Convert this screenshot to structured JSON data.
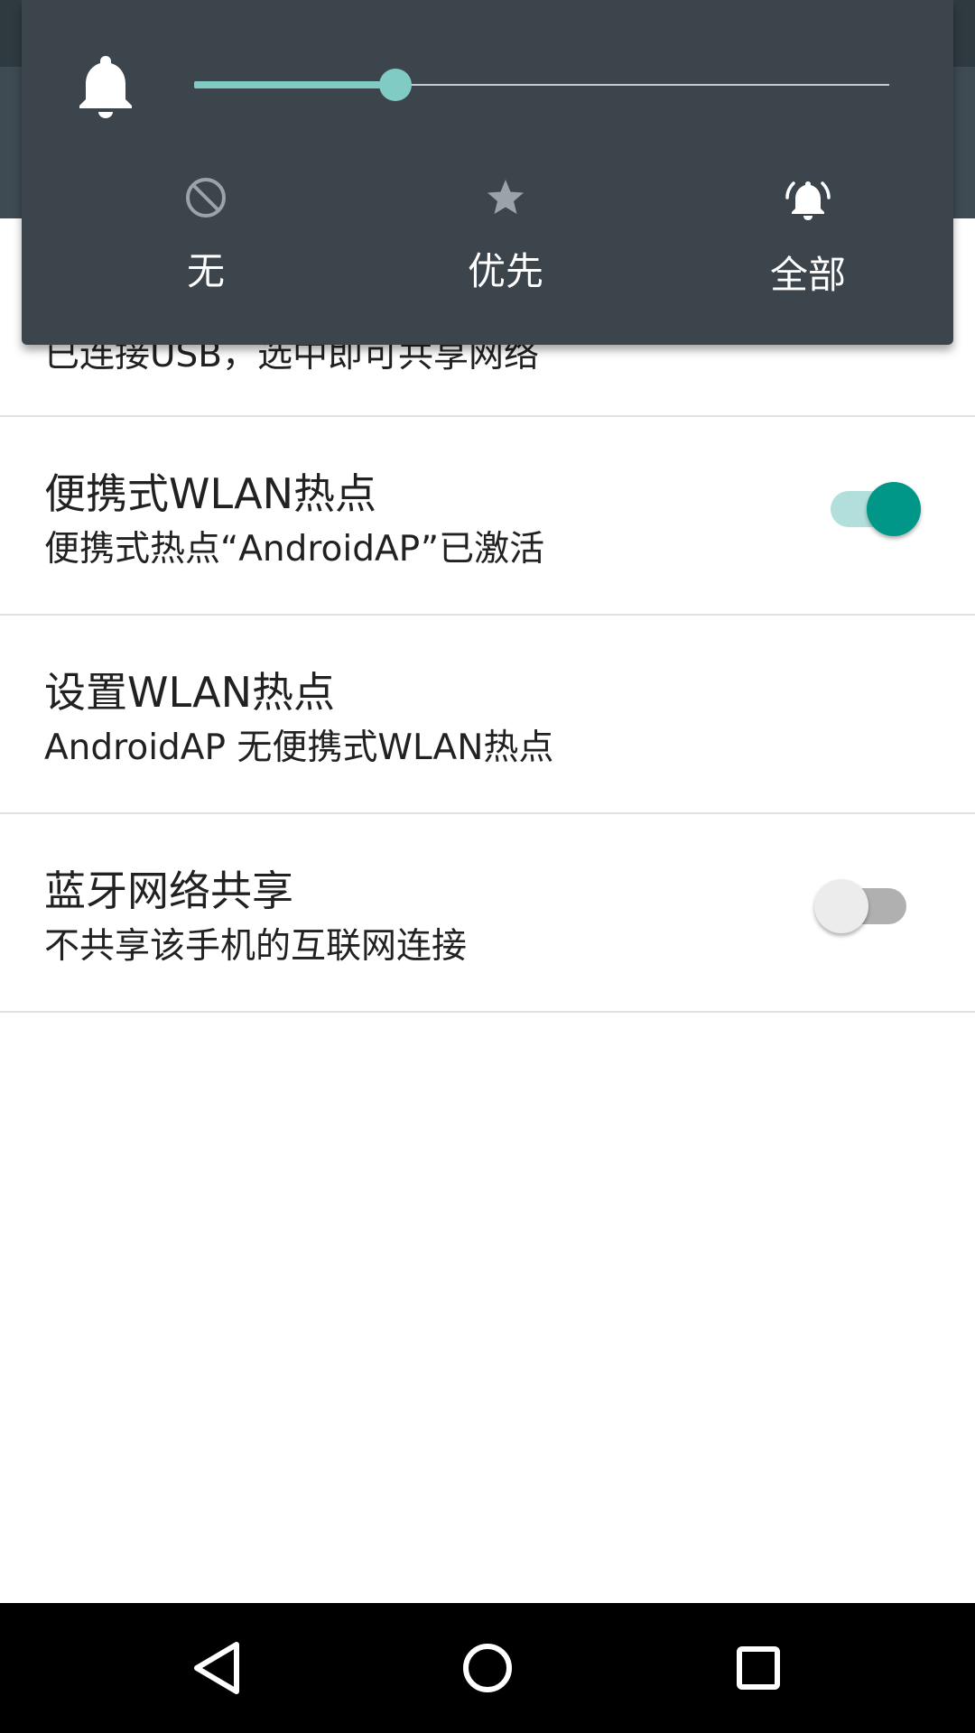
{
  "settings": {
    "usb": {
      "summary": "已连接USB，选中即可共享网络"
    },
    "hotspot": {
      "title": "便携式WLAN热点",
      "summary": "便携式热点“AndroidAP”已激活",
      "enabled": true
    },
    "setup_hotspot": {
      "title": "设置WLAN热点",
      "summary": "AndroidAP 无便携式WLAN热点"
    },
    "bluetooth": {
      "title": "蓝牙网络共享",
      "summary": "不共享该手机的互联网连接",
      "enabled": false
    }
  },
  "volume_panel": {
    "level_fraction": 0.29,
    "modes": [
      {
        "label": "无",
        "icon": "do-not-disturb-icon",
        "selected": false
      },
      {
        "label": "优先",
        "icon": "star-icon",
        "selected": false
      },
      {
        "label": "全部",
        "icon": "ringing-bell-icon",
        "selected": true
      }
    ]
  },
  "navigation": {
    "back": "back-icon",
    "home": "home-icon",
    "recents": "recents-icon"
  },
  "colors": {
    "accent": "#009688",
    "accent_light": "#80cbc4",
    "panel": "#3c444c",
    "unselected_icon": "#9aa3a9"
  }
}
